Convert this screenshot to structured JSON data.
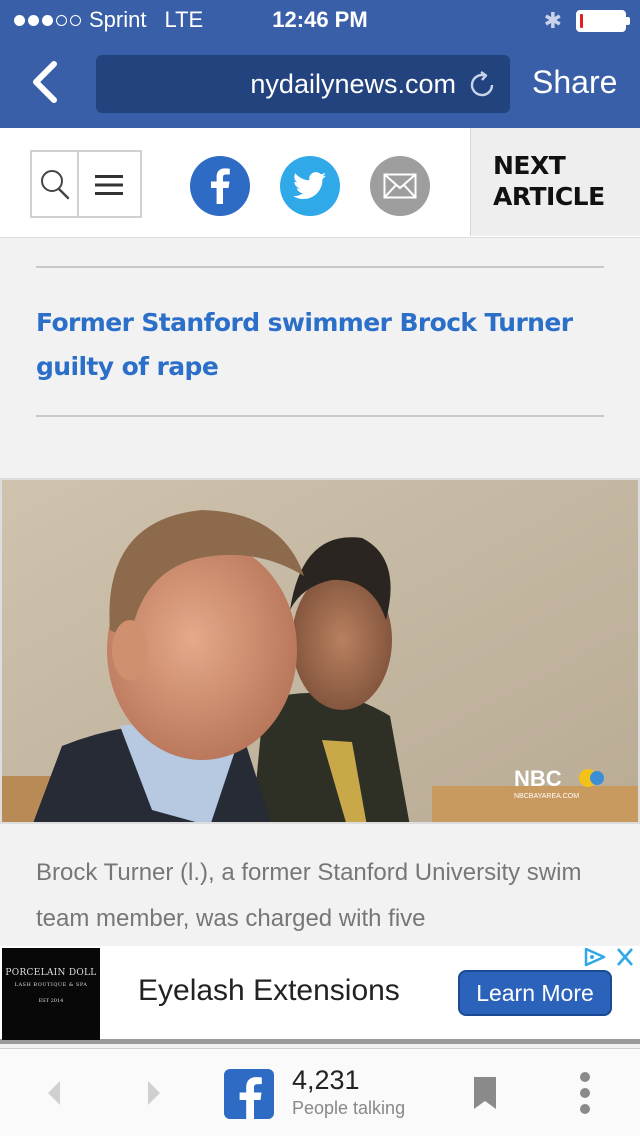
{
  "status_bar": {
    "carrier": "Sprint",
    "network": "LTE",
    "time": "12:46 PM",
    "signal_bars_filled": 3,
    "signal_bars_total": 5,
    "battery_level": 0.08,
    "battery_color": "#e02020"
  },
  "browser": {
    "url": "nydailynews.com",
    "share_label": "Share",
    "back_icon": "chevron-left-icon",
    "reload_icon": "reload-icon",
    "bar_color": "#3a5fa9"
  },
  "site_header": {
    "next_article_label": "NEXT ARTICLE",
    "social": [
      "facebook-icon",
      "twitter-icon",
      "mail-icon"
    ],
    "colors": {
      "facebook": "#2d6bc4",
      "twitter": "#2fa9e8",
      "mail": "#9e9e9e"
    }
  },
  "article": {
    "headline": "Former Stanford swimmer Brock Turner guilty of rape",
    "photo_watermark": "NBC",
    "photo_watermark_sub": "NBCBAYAREA.COM",
    "caption": "Brock Turner (l.), a former Stanford University swim team member, was charged with five",
    "headline_color": "#2b6fc8"
  },
  "ad": {
    "logo_line1": "PORCELAIN DOLL",
    "logo_line2": "LASH BOUTIQUE & SPA",
    "logo_line3": "EST 2014",
    "title": "Eyelash Extensions",
    "cta": "Learn More",
    "adchoices_icon": "adchoices-icon",
    "close_icon": "close-icon",
    "cta_color": "#2b63bb"
  },
  "toolbar": {
    "share_count": "4,231",
    "share_label": "People talking",
    "icons": [
      "back-icon",
      "forward-icon",
      "facebook-icon",
      "bookmark-icon",
      "more-icon"
    ]
  }
}
